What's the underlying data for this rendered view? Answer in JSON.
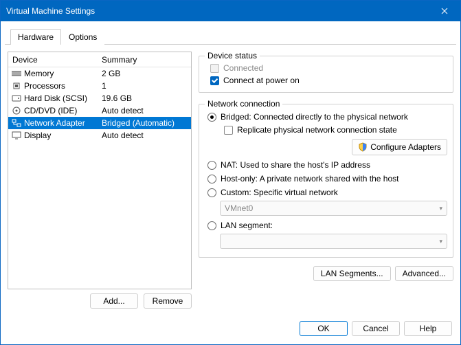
{
  "title": "Virtual Machine Settings",
  "tabs": {
    "hardware": "Hardware",
    "options": "Options"
  },
  "listHeader": {
    "device": "Device",
    "summary": "Summary"
  },
  "devices": [
    {
      "name": "Memory",
      "summary": "2 GB"
    },
    {
      "name": "Processors",
      "summary": "1"
    },
    {
      "name": "Hard Disk (SCSI)",
      "summary": "19.6 GB"
    },
    {
      "name": "CD/DVD (IDE)",
      "summary": "Auto detect"
    },
    {
      "name": "Network Adapter",
      "summary": "Bridged (Automatic)"
    },
    {
      "name": "Display",
      "summary": "Auto detect"
    }
  ],
  "leftButtons": {
    "add": "Add...",
    "remove": "Remove"
  },
  "groups": {
    "status": {
      "legend": "Device status",
      "connected": "Connected",
      "powerOn": "Connect at power on"
    },
    "network": {
      "legend": "Network connection",
      "bridged": "Bridged: Connected directly to the physical network",
      "replicate": "Replicate physical network connection state",
      "configure": "Configure Adapters",
      "nat": "NAT: Used to share the host's IP address",
      "hostOnly": "Host-only: A private network shared with the host",
      "custom": "Custom: Specific virtual network",
      "customValue": "VMnet0",
      "lan": "LAN segment:",
      "lanValue": ""
    }
  },
  "rightButtons": {
    "lanSeg": "LAN Segments...",
    "advanced": "Advanced..."
  },
  "footer": {
    "ok": "OK",
    "cancel": "Cancel",
    "help": "Help"
  }
}
